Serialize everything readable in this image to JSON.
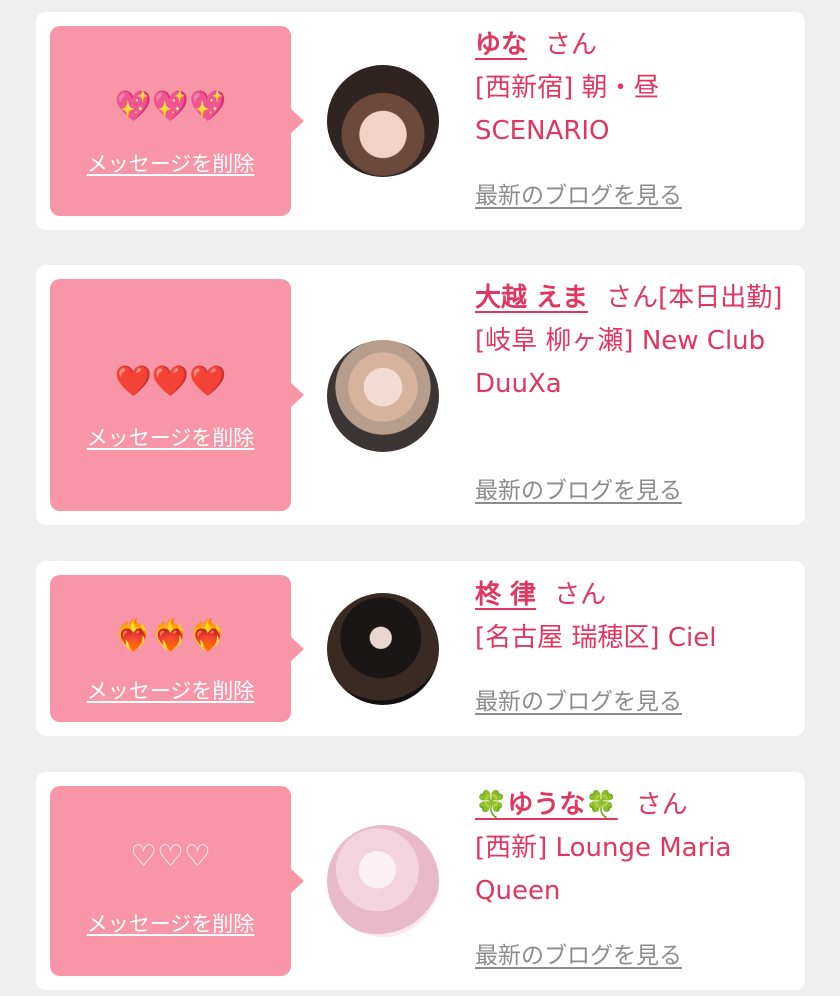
{
  "cards": [
    {
      "hearts": "💖💖💖",
      "delete_label": "メッセージを削除",
      "name": "ゆな",
      "suffix": "さん",
      "shop": "[西新宿] 朝・昼 SCENARIO",
      "blog_label": "最新のブログを見る"
    },
    {
      "hearts": "❤️❤️❤️",
      "delete_label": "メッセージを削除",
      "name": "大越 えま",
      "suffix": "さん[本日出勤]",
      "shop": "[岐阜 柳ヶ瀬] New Club DuuXa",
      "blog_label": "最新のブログを見る"
    },
    {
      "hearts": "❤️‍🔥❤️‍🔥❤️‍🔥",
      "delete_label": "メッセージを削除",
      "name": "柊 律",
      "suffix": "さん",
      "shop": "[名古屋 瑞穂区] Ciel",
      "blog_label": "最新のブログを見る"
    },
    {
      "hearts": "♡♡♡",
      "delete_label": "メッセージを削除",
      "name": "🍀ゆうな🍀",
      "suffix": "さん",
      "shop": "[西新] Lounge Maria Queen",
      "blog_label": "最新のブログを見る"
    }
  ],
  "colors": {
    "accent": "#e1365f",
    "bubble": "#f895a7",
    "background": "#efefef",
    "blog_link": "#8c8c8c"
  }
}
